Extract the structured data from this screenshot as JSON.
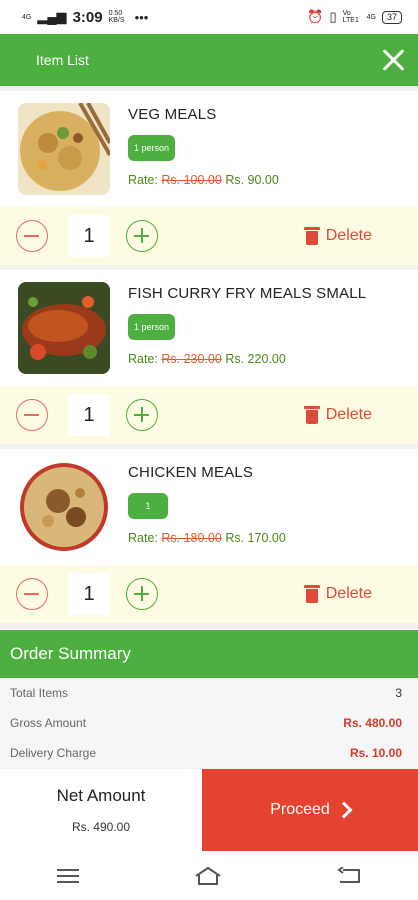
{
  "status": {
    "time": "3:09",
    "speed": "0.50 KB/S",
    "battery": "37",
    "net": "Vo LTE1",
    "g4": "4G",
    "more": "•••"
  },
  "appbar": {
    "title": "Item List"
  },
  "items": [
    {
      "name": "VEG MEALS",
      "badge": "1 person",
      "rate_label": "Rate:",
      "old_price": "Rs. 100.00",
      "new_price": "Rs. 90.00",
      "qty": "1",
      "delete_label": "Delete"
    },
    {
      "name": "FISH CURRY FRY MEALS SMALL",
      "badge": "1 person",
      "rate_label": "Rate:",
      "old_price": "Rs. 230.00",
      "new_price": "Rs. 220.00",
      "qty": "1",
      "delete_label": "Delete"
    },
    {
      "name": "CHICKEN MEALS",
      "badge": "1",
      "rate_label": "Rate:",
      "old_price": "Rs. 180.00",
      "new_price": "Rs. 170.00",
      "qty": "1",
      "delete_label": "Delete"
    }
  ],
  "summary": {
    "title": "Order Summary",
    "total_items_label": "Total Items",
    "total_items": "3",
    "gross_label": "Gross Amount",
    "gross": "Rs. 480.00",
    "delivery_label": "Delivery Charge",
    "delivery": "Rs. 10.00"
  },
  "footer": {
    "net_label": "Net Amount",
    "net_amount": "Rs. 490.00",
    "proceed_label": "Proceed"
  },
  "colors": {
    "brand_green": "#4caf3f",
    "proceed_red": "#e44331",
    "delete_red": "#e04a3a"
  }
}
